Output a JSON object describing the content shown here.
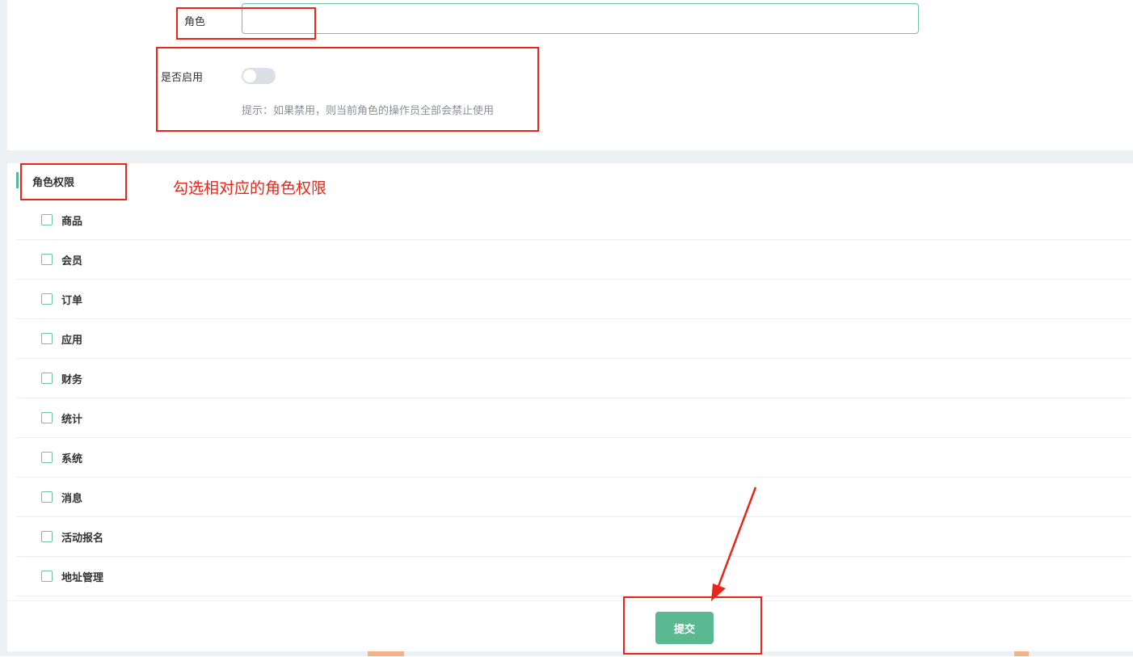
{
  "form": {
    "role_label": "角色",
    "role_input_value": "",
    "enable_label": "是否启用",
    "enable_on": false,
    "hint": "提示：如果禁用，则当前角色的操作员全部会禁止使用"
  },
  "permissions": {
    "section_title": "角色权限",
    "annotation": "勾选相对应的角色权限",
    "items": [
      {
        "label": "商品"
      },
      {
        "label": "会员"
      },
      {
        "label": "订单"
      },
      {
        "label": "应用"
      },
      {
        "label": "财务"
      },
      {
        "label": "统计"
      },
      {
        "label": "系统"
      },
      {
        "label": "消息"
      },
      {
        "label": "活动报名"
      },
      {
        "label": "地址管理"
      }
    ]
  },
  "footer": {
    "submit_label": "提交"
  },
  "colors": {
    "accent": "#5bb992",
    "annotation": "#e8261a"
  }
}
